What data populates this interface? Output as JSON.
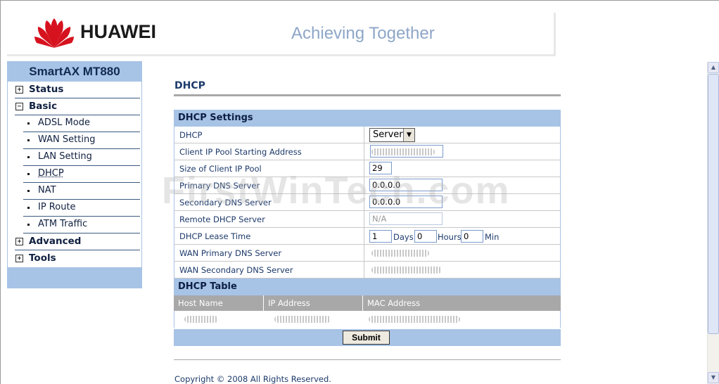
{
  "header": {
    "brand": "HUAWEI",
    "slogan": "Achieving Together"
  },
  "sidebar": {
    "title": "SmartAX MT880",
    "items": [
      {
        "label": "Status",
        "type": "top",
        "state": "+"
      },
      {
        "label": "Basic",
        "type": "top",
        "state": "−"
      },
      {
        "label": "ADSL Mode",
        "type": "sub"
      },
      {
        "label": "WAN Setting",
        "type": "sub"
      },
      {
        "label": "LAN Setting",
        "type": "sub"
      },
      {
        "label": "DHCP",
        "type": "sub",
        "active": true
      },
      {
        "label": "NAT",
        "type": "sub"
      },
      {
        "label": "IP Route",
        "type": "sub"
      },
      {
        "label": "ATM Traffic",
        "type": "sub"
      },
      {
        "label": "Advanced",
        "type": "top",
        "state": "+"
      },
      {
        "label": "Tools",
        "type": "top",
        "state": "+"
      }
    ]
  },
  "main": {
    "title": "DHCP",
    "settings": {
      "heading": "DHCP Settings",
      "dhcp_label": "DHCP",
      "dhcp_value": "Server",
      "pool_start_label": "Client IP Pool Starting Address",
      "pool_size_label": "Size of Client IP Pool",
      "pool_size_value": "29",
      "primary_dns_label": "Primary DNS Server",
      "primary_dns_value": "0.0.0.0",
      "secondary_dns_label": "Secondary DNS Server",
      "secondary_dns_value": "0.0.0.0",
      "remote_dhcp_label": "Remote DHCP Server",
      "remote_dhcp_value": "N/A",
      "lease_label": "DHCP Lease Time",
      "lease_days": "1",
      "lease_days_unit": "Days",
      "lease_hours": "0",
      "lease_hours_unit": "Hours",
      "lease_min": "0",
      "lease_min_unit": "Min",
      "wan_primary_label": "WAN Primary DNS Server",
      "wan_secondary_label": "WAN Secondary DNS Server"
    },
    "table": {
      "heading": "DHCP Table",
      "columns": [
        "Host Name",
        "IP Address",
        "MAC Address"
      ]
    },
    "submit_label": "Submit",
    "copyright": "Copyright © 2008 All Rights Reserved."
  },
  "watermark": "FirstWinTech.com",
  "colors": {
    "accent": "#a7c3e6",
    "header_text": "#1d3a6b",
    "table_header": "#a8a8a8"
  }
}
